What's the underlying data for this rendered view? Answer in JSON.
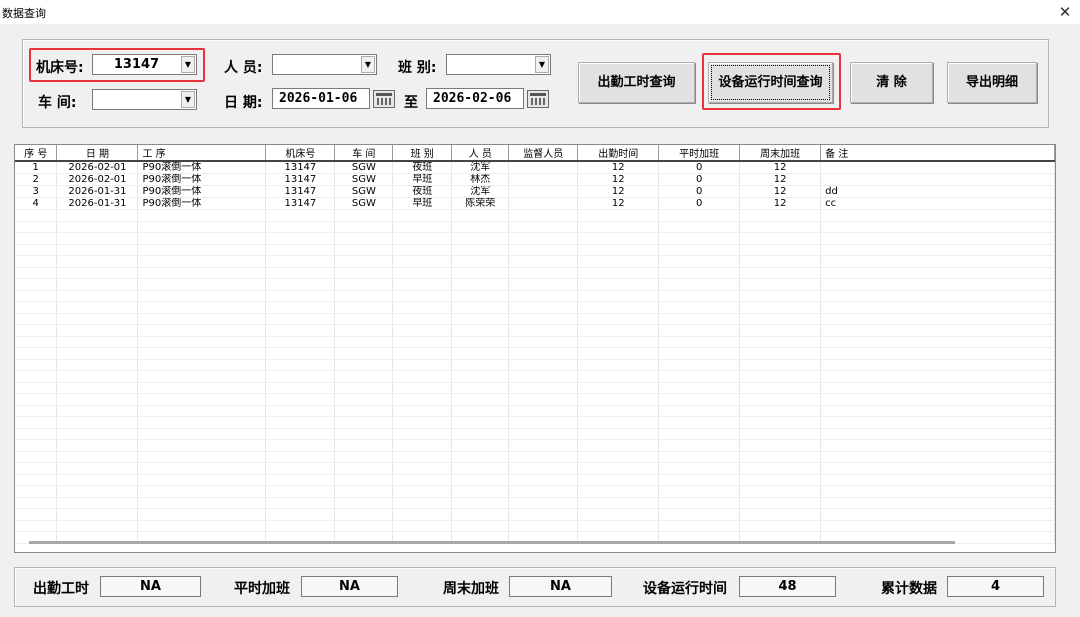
{
  "window": {
    "title": "数据查询",
    "close": "✕"
  },
  "filters": {
    "machine_label": "机床号:",
    "machine_value": "13147",
    "person_label": "人 员:",
    "person_value": "",
    "shift_label": "班 别:",
    "shift_value": "",
    "workshop_label": "车 间:",
    "workshop_value": "",
    "date_label": "日 期:",
    "date_from": "2026-01-06",
    "date_to_label": "至",
    "date_to": "2026-02-06"
  },
  "buttons": {
    "attendance_query": "出勤工时查询",
    "equipment_query": "设备运行时间查询",
    "clear": "清 除",
    "export": "导出明细"
  },
  "table": {
    "columns": [
      "序 号",
      "日 期",
      "工 序",
      "机床号",
      "车 间",
      "班 别",
      "人 员",
      "监督人员",
      "出勤时间",
      "平时加班",
      "周末加班",
      "备 注"
    ],
    "rows": [
      [
        "1",
        "2026-02-01",
        "P90滚倒一体",
        "13147",
        "SGW",
        "夜班",
        "沈军",
        "",
        "12",
        "0",
        "12",
        ""
      ],
      [
        "2",
        "2026-02-01",
        "P90滚倒一体",
        "13147",
        "SGW",
        "早班",
        "林杰",
        "",
        "12",
        "0",
        "12",
        ""
      ],
      [
        "3",
        "2026-01-31",
        "P90滚倒一体",
        "13147",
        "SGW",
        "夜班",
        "沈军",
        "",
        "12",
        "0",
        "12",
        "dd"
      ],
      [
        "4",
        "2026-01-31",
        "P90滚倒一体",
        "13147",
        "SGW",
        "早班",
        "陈荣荣",
        "",
        "12",
        "0",
        "12",
        "cc"
      ]
    ]
  },
  "summary": {
    "attendance_label": "出勤工时",
    "attendance_value": "NA",
    "overtime_label": "平时加班",
    "overtime_value": "NA",
    "weekend_label": "周末加班",
    "weekend_value": "NA",
    "runtime_label": "设备运行时间",
    "runtime_value": "48",
    "total_label": "累计数据",
    "total_value": "4"
  },
  "colors": {
    "highlight": "#e8323c",
    "background": "#f0f0f0"
  }
}
